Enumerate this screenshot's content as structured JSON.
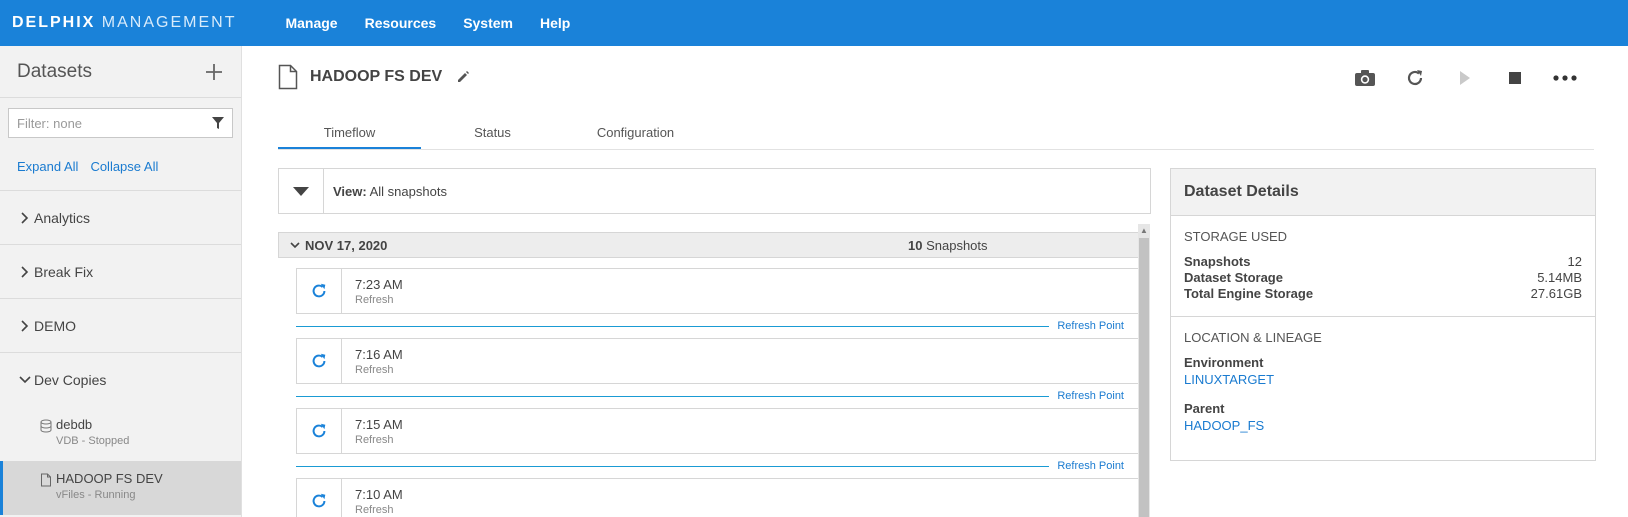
{
  "brand": {
    "bold": "DELPHIX",
    "light": "MANAGEMENT"
  },
  "topnav": [
    "Manage",
    "Resources",
    "System",
    "Help"
  ],
  "sidebar": {
    "title": "Datasets",
    "filter_placeholder": "Filter: none",
    "expand_all": "Expand All",
    "collapse_all": "Collapse All",
    "groups": [
      "Analytics",
      "Break Fix",
      "DEMO",
      "Dev Copies"
    ],
    "items": [
      {
        "name": "debdb",
        "status": "VDB - Stopped"
      },
      {
        "name": "HADOOP FS DEV",
        "status": "vFiles - Running"
      }
    ]
  },
  "main": {
    "title": "HADOOP FS DEV",
    "tabs": [
      "Timeflow",
      "Status",
      "Configuration"
    ],
    "view_label": "View:",
    "view_value": "All snapshots",
    "day": {
      "date": "NOV 17, 2020",
      "count": "10",
      "count_label": "Snapshots"
    },
    "snapshots": [
      {
        "time": "7:23 AM",
        "type": "Refresh"
      },
      {
        "time": "7:16 AM",
        "type": "Refresh"
      },
      {
        "time": "7:15 AM",
        "type": "Refresh"
      },
      {
        "time": "7:10 AM",
        "type": "Refresh"
      }
    ],
    "refresh_point_label": "Refresh Point"
  },
  "details": {
    "title": "Dataset Details",
    "storage_caption": "STORAGE USED",
    "storage": [
      {
        "key": "Snapshots",
        "value": "12"
      },
      {
        "key": "Dataset Storage",
        "value": "5.14MB"
      },
      {
        "key": "Total Engine Storage",
        "value": "27.61GB"
      }
    ],
    "location_caption": "LOCATION & LINEAGE",
    "environment_label": "Environment",
    "environment_value": "LINUXTARGET",
    "parent_label": "Parent",
    "parent_value": "HADOOP_FS"
  },
  "colors": {
    "accent": "#1a82d9",
    "link": "#1a7bd0"
  }
}
